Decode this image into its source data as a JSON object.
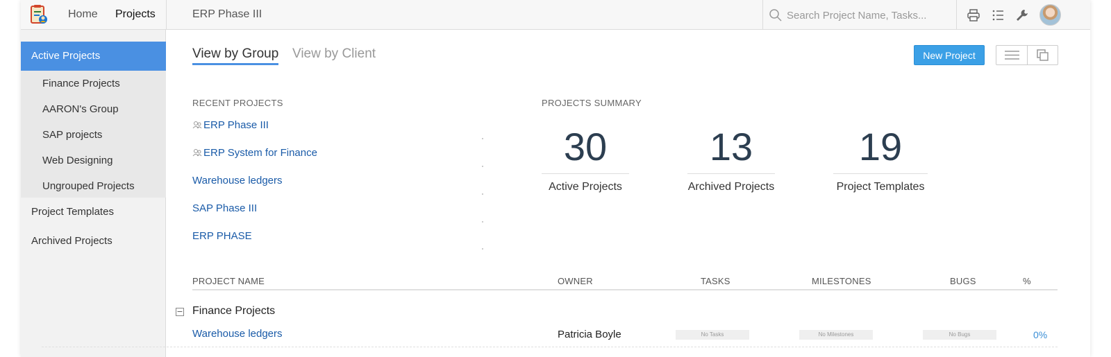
{
  "topbar": {
    "nav_home": "Home",
    "nav_projects": "Projects",
    "breadcrumb": "ERP Phase III",
    "search_placeholder": "Search Project Name, Tasks..."
  },
  "sidebar": {
    "active": "Active Projects",
    "sub_items": [
      "Finance Projects",
      "AARON's Group",
      "SAP projects",
      "Web Designing",
      "Ungrouped Projects"
    ],
    "items": [
      "Project Templates",
      "Archived Projects"
    ]
  },
  "tabs": {
    "by_group": "View by Group",
    "by_client": "View by Client"
  },
  "toolbar": {
    "new_project": "New Project"
  },
  "recent": {
    "title": "RECENT PROJECTS",
    "items": [
      "ERP Phase III",
      "ERP System for Finance",
      "Warehouse ledgers",
      "SAP Phase III",
      "ERP PHASE"
    ]
  },
  "summary": {
    "title": "PROJECTS SUMMARY",
    "stats": [
      {
        "value": "30",
        "label": "Active Projects"
      },
      {
        "value": "13",
        "label": "Archived Projects"
      },
      {
        "value": "19",
        "label": "Project Templates"
      }
    ]
  },
  "table": {
    "headers": [
      "PROJECT NAME",
      "OWNER",
      "TASKS",
      "MILESTONES",
      "BUGS",
      "%"
    ],
    "group": "Finance Projects",
    "rows": [
      {
        "name": "Warehouse ledgers",
        "owner": "Patricia Boyle",
        "tasks": "No Tasks",
        "milestones": "No Milestones",
        "bugs": "No Bugs",
        "percent": "0%"
      }
    ]
  },
  "colors": {
    "accent": "#4a90e2",
    "button": "#3ba0e6",
    "link": "#1a5ba8"
  }
}
